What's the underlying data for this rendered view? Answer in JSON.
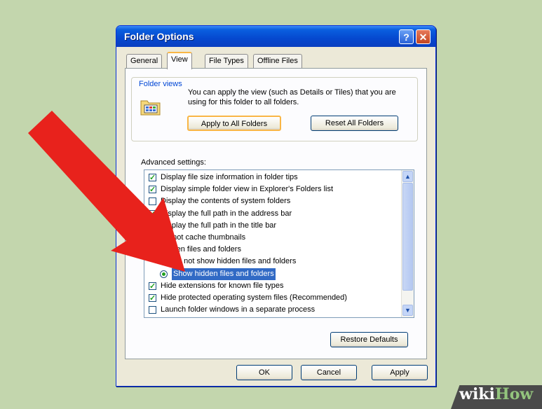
{
  "window": {
    "title": "Folder Options",
    "help_btn": "?",
    "close_btn": "✕"
  },
  "tabs": [
    {
      "label": "General",
      "active": false
    },
    {
      "label": "View",
      "active": true
    },
    {
      "label": "File Types",
      "active": false
    },
    {
      "label": "Offline Files",
      "active": false
    }
  ],
  "folder_views": {
    "label": "Folder views",
    "description": "You can apply the view (such as Details or Tiles) that you are using for this folder to all folders.",
    "apply_all_label": "Apply to All Folders",
    "reset_all_label": "Reset All Folders"
  },
  "advanced": {
    "label": "Advanced settings:",
    "items": [
      {
        "type": "checkbox",
        "checked": true,
        "label": "Display file size information in folder tips"
      },
      {
        "type": "checkbox",
        "checked": true,
        "label": "Display simple folder view in Explorer's Folders list"
      },
      {
        "type": "checkbox",
        "checked": false,
        "label": "Display the contents of system folders"
      },
      {
        "type": "checkbox",
        "checked": true,
        "label": "Display the full path in the address bar"
      },
      {
        "type": "checkbox",
        "checked": false,
        "label": "Display the full path in the title bar"
      },
      {
        "type": "checkbox",
        "checked": false,
        "label": "Do not cache thumbnails"
      },
      {
        "type": "folder",
        "label": "Hidden files and folders"
      },
      {
        "type": "radio",
        "checked": false,
        "label": "Do not show hidden files and folders"
      },
      {
        "type": "radio",
        "checked": true,
        "selected": true,
        "label": "Show hidden files and folders"
      },
      {
        "type": "checkbox",
        "checked": true,
        "label": "Hide extensions for known file types"
      },
      {
        "type": "checkbox",
        "checked": true,
        "label": "Hide protected operating system files (Recommended)"
      },
      {
        "type": "checkbox",
        "checked": false,
        "label": "Launch folder windows in a separate process"
      }
    ],
    "restore_label": "Restore Defaults"
  },
  "footer": {
    "ok_label": "OK",
    "cancel_label": "Cancel",
    "apply_label": "Apply"
  },
  "watermark": {
    "wiki": "wiki",
    "how": "How"
  },
  "colors": {
    "arrow": "#e8221c",
    "title_bar": "#0a5fdf",
    "selection": "#316ac5",
    "background": "#c3d6ad"
  }
}
